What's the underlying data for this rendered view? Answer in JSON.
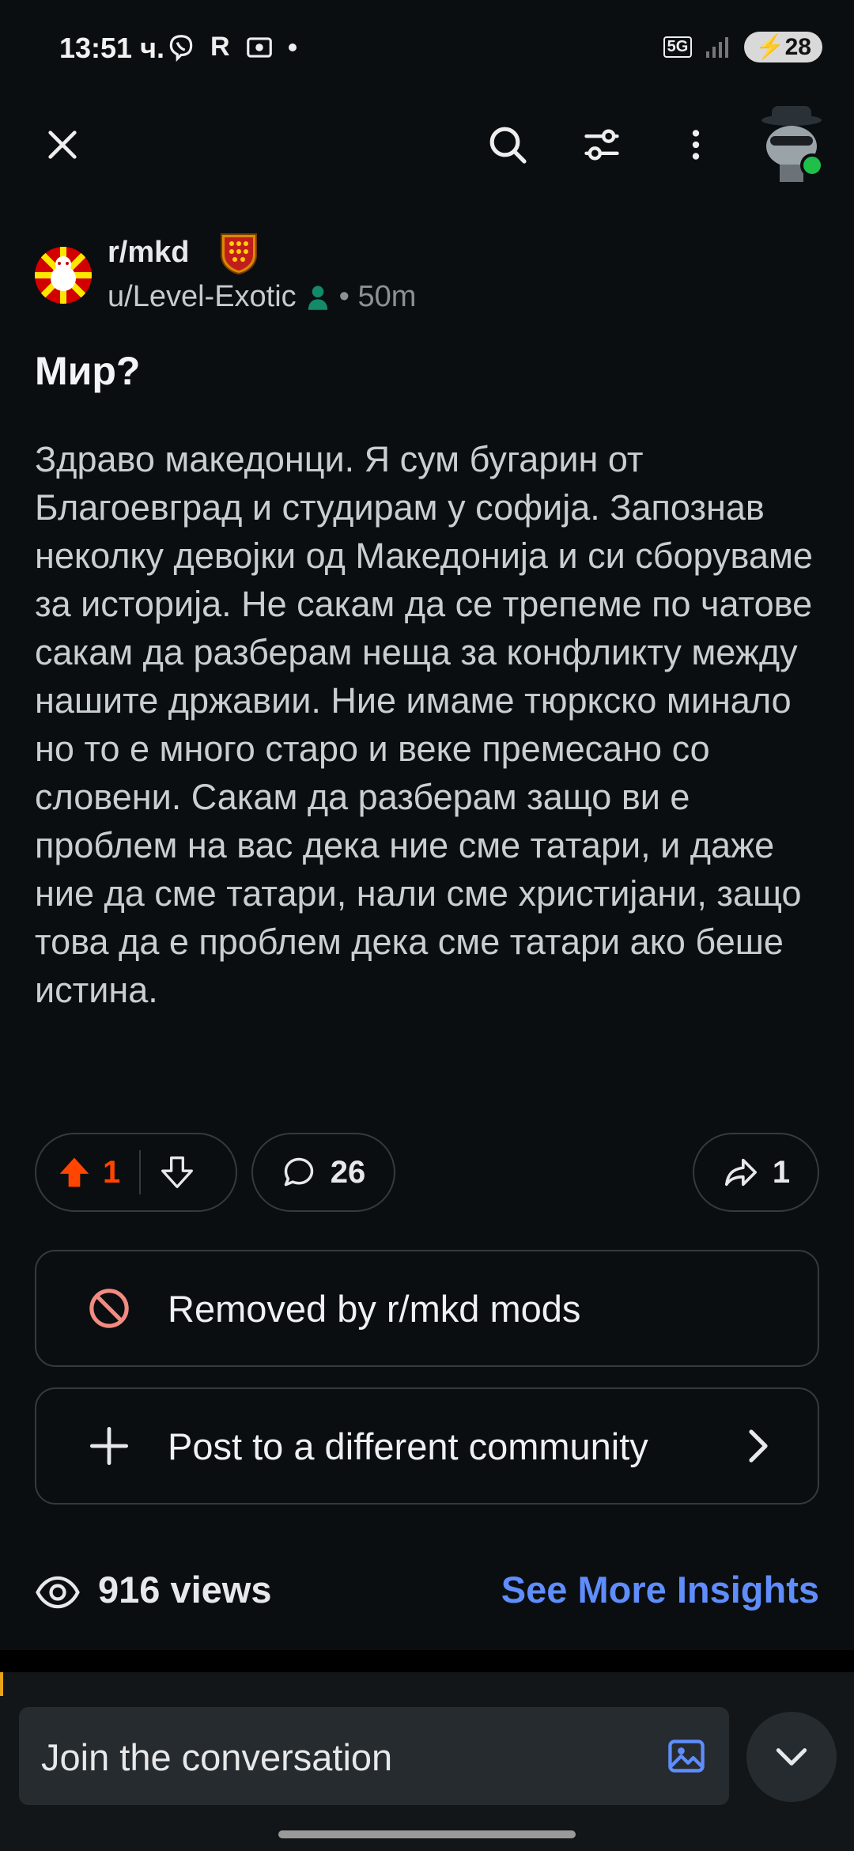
{
  "status_bar": {
    "time": "13:51 ч.",
    "left_icons": [
      "viber-icon",
      "r-letter-icon",
      "screen-capture-icon",
      "dot-icon"
    ],
    "network": "5G",
    "battery": "28"
  },
  "topbar": {
    "icons": [
      "close-icon",
      "search-icon",
      "filter-icon",
      "more-vertical-icon",
      "user-avatar"
    ]
  },
  "post": {
    "subreddit": "r/mkd",
    "author": "u/Level-Exotic",
    "age": "• 50m",
    "title": "Мир?",
    "body": "Здраво македонци. Я сум бугарин от Благоевград и студирам у софија. Запознав неколку девојки од Македонија и си сборуваме за историја. Не сакам да се трепеме по чатове сакам да разберам неща за конфликту между нашите државии. Ние имаме тюркско минало но то е много старо и веке премесано со словени. Сакам да разберам защо ви е проблем на вас дека ние сме татари, и даже ние да сме татари, нали сме христијани, защо това да е проблем дека сме татари ако беше истина.",
    "upvotes": "1",
    "comments": "26",
    "shares": "1"
  },
  "cards": {
    "removed_label": "Removed by r/mkd mods",
    "crosspost_label": "Post to a different community"
  },
  "insights": {
    "views": "916 views",
    "see_more": "See More Insights"
  },
  "composer": {
    "placeholder": "Join the conversation"
  },
  "colors": {
    "background": "#0b0e10",
    "upvote": "#ff4500",
    "link": "#5f8dfc",
    "removed_icon": "#f28b82"
  }
}
